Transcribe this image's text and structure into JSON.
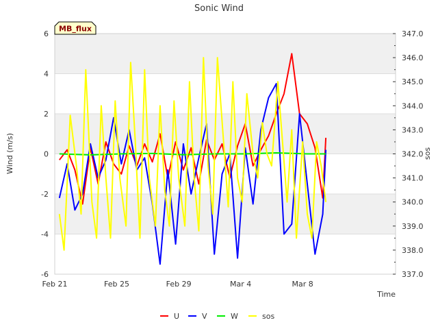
{
  "chart_data": {
    "type": "line",
    "title": "Sonic Wind",
    "badge": "MB_flux",
    "xlabel": "Time",
    "ylabel_left": "Wind (m/s)",
    "ylabel_right": "sos",
    "xlim": [
      0,
      22
    ],
    "ylim_left": [
      -6,
      6
    ],
    "ylim_right": [
      337.0,
      347.0
    ],
    "x_ticks": [
      {
        "x": 0,
        "label": "Feb 21"
      },
      {
        "x": 4,
        "label": "Feb 25"
      },
      {
        "x": 8,
        "label": "Feb 29"
      },
      {
        "x": 12,
        "label": "Mar 4"
      },
      {
        "x": 16,
        "label": "Mar 8"
      }
    ],
    "y_ticks_left": [
      "6",
      "4",
      "2",
      "0",
      "-2",
      "-4",
      "-6"
    ],
    "y_ticks_right": [
      "347.0",
      "346.0",
      "345.0",
      "344.0",
      "343.0",
      "342.0",
      "341.0",
      "340.0",
      "339.0",
      "338.0",
      "337.0"
    ],
    "grid": true,
    "legend_position": "bottom",
    "series": [
      {
        "name": "U",
        "axis": "left",
        "color": "#ff0000",
        "x": [
          0.3,
          0.8,
          1.3,
          1.8,
          2.3,
          2.8,
          3.3,
          3.8,
          4.3,
          4.8,
          5.3,
          5.8,
          6.3,
          6.8,
          7.3,
          7.8,
          8.3,
          8.8,
          9.3,
          9.8,
          10.3,
          10.8,
          11.3,
          11.8,
          12.3,
          12.8,
          13.3,
          13.8,
          14.3,
          14.8,
          15.3,
          15.8,
          16.3,
          16.8,
          17.3,
          17.5
        ],
        "y": [
          -0.3,
          0.2,
          -0.8,
          -2.5,
          0.3,
          -1.5,
          0.6,
          -0.5,
          -1.0,
          0.4,
          -0.6,
          0.5,
          -0.4,
          1.0,
          -1.2,
          0.6,
          -0.8,
          0.3,
          -1.5,
          0.7,
          -0.3,
          0.5,
          -1.2,
          0.4,
          1.5,
          -0.6,
          0.2,
          0.9,
          2.0,
          3.0,
          5.0,
          2.0,
          1.5,
          0.3,
          -2.2,
          0.8
        ]
      },
      {
        "name": "V",
        "axis": "left",
        "color": "#0000ff",
        "x": [
          0.3,
          0.8,
          1.3,
          1.8,
          2.3,
          2.8,
          3.3,
          3.8,
          4.3,
          4.8,
          5.3,
          5.8,
          6.3,
          6.8,
          7.3,
          7.8,
          8.3,
          8.8,
          9.3,
          9.8,
          10.3,
          10.8,
          11.3,
          11.8,
          12.3,
          12.8,
          13.3,
          13.8,
          14.3,
          14.8,
          15.3,
          15.8,
          16.3,
          16.8,
          17.3,
          17.5
        ],
        "y": [
          -2.2,
          -0.5,
          -2.8,
          -2.0,
          0.5,
          -1.2,
          -0.3,
          1.8,
          -0.5,
          1.2,
          -0.8,
          -0.2,
          -2.5,
          -5.5,
          -0.8,
          -4.5,
          0.5,
          -2.0,
          -0.2,
          1.5,
          -5.0,
          -1.0,
          0.0,
          -5.2,
          0.3,
          -2.5,
          1.2,
          2.8,
          3.5,
          -4.0,
          -3.5,
          2.0,
          -1.5,
          -5.0,
          -3.0,
          0.2
        ]
      },
      {
        "name": "W",
        "axis": "left",
        "color": "#00ee00",
        "x": [
          0.3,
          2.3,
          4.3,
          6.3,
          8.3,
          10.3,
          12.3,
          14.3,
          16.3,
          17.5
        ],
        "y": [
          0.0,
          -0.05,
          0.0,
          0.02,
          -0.04,
          0.0,
          0.0,
          0.05,
          0.0,
          0.0
        ]
      },
      {
        "name": "sos",
        "axis": "right",
        "color": "#ffff00",
        "x": [
          0.3,
          0.6,
          1.0,
          1.4,
          1.7,
          2.0,
          2.4,
          2.7,
          3.0,
          3.3,
          3.6,
          3.9,
          4.2,
          4.6,
          4.9,
          5.2,
          5.5,
          5.8,
          6.1,
          6.5,
          6.8,
          7.1,
          7.4,
          7.7,
          8.0,
          8.4,
          8.7,
          9.0,
          9.3,
          9.6,
          9.9,
          10.2,
          10.5,
          10.9,
          11.2,
          11.5,
          11.8,
          12.1,
          12.4,
          12.8,
          13.1,
          13.4,
          13.7,
          14.0,
          14.4,
          14.7,
          15.0,
          15.3,
          15.6,
          16.0,
          16.3,
          16.6,
          16.9,
          17.2,
          17.5
        ],
        "y": [
          339.5,
          338.0,
          343.6,
          341.5,
          339.5,
          345.5,
          340.0,
          338.5,
          344.0,
          341.0,
          338.5,
          344.2,
          341.0,
          339.0,
          345.8,
          342.5,
          338.5,
          345.5,
          341.0,
          339.0,
          344.0,
          340.5,
          339.0,
          344.2,
          341.0,
          339.0,
          345.0,
          341.0,
          338.8,
          346.0,
          341.5,
          339.5,
          346.0,
          342.5,
          339.8,
          345.0,
          341.0,
          340.0,
          344.5,
          342.0,
          341.0,
          343.3,
          342.0,
          341.5,
          345.0,
          342.5,
          340.0,
          343.0,
          338.5,
          342.5,
          339.5,
          338.5,
          342.5,
          341.5,
          340.0
        ]
      }
    ]
  }
}
